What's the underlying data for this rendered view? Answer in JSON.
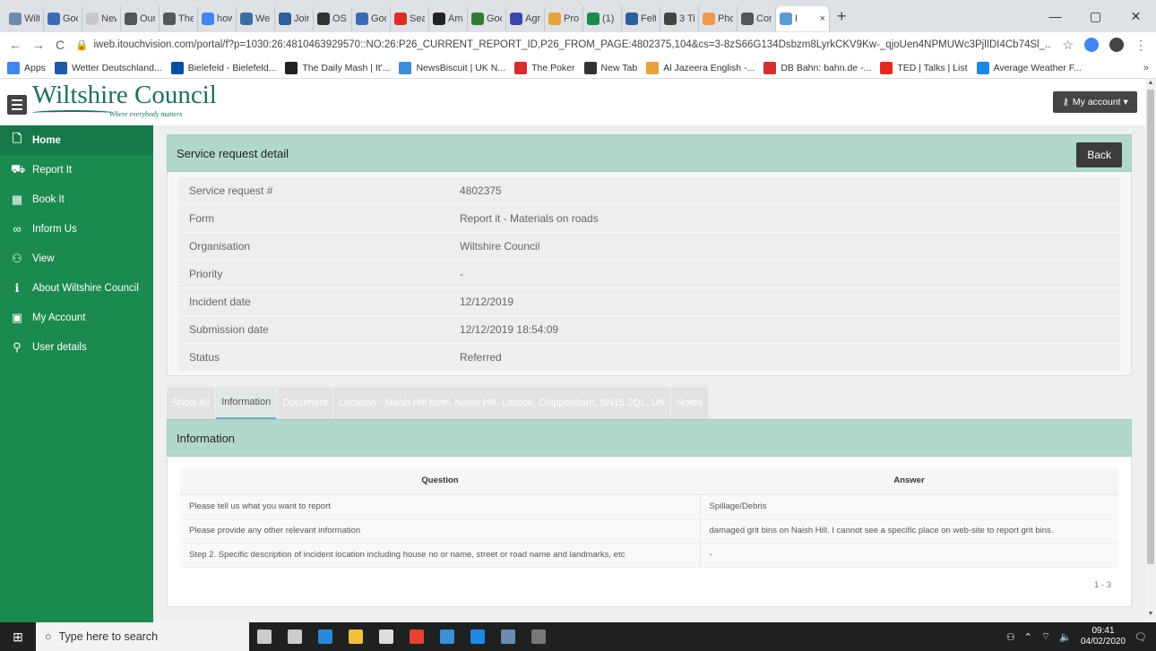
{
  "browser": {
    "tabs": [
      {
        "label": "Wilt",
        "color": "#6a8caf"
      },
      {
        "label": "Goo",
        "color": "#3b6bb5"
      },
      {
        "label": "New",
        "color": "#c9c9c9"
      },
      {
        "label": "Our",
        "color": "#555555"
      },
      {
        "label": "The",
        "color": "#555555"
      },
      {
        "label": "how",
        "color": "#4285f4"
      },
      {
        "label": "Wei",
        "color": "#3a6ea5"
      },
      {
        "label": "Join",
        "color": "#2b5f9e"
      },
      {
        "label": "OS",
        "color": "#333333"
      },
      {
        "label": "Goo",
        "color": "#3b6bb5"
      },
      {
        "label": "Sea",
        "color": "#d93025"
      },
      {
        "label": "Am",
        "color": "#222222"
      },
      {
        "label": "Goo",
        "color": "#2e7d32"
      },
      {
        "label": "Agr",
        "color": "#3949ab"
      },
      {
        "label": "Pro",
        "color": "#e6a23c"
      },
      {
        "label": "(1)",
        "color": "#1a8a4f"
      },
      {
        "label": "Felt",
        "color": "#2b5f9e"
      },
      {
        "label": "3 Ti",
        "color": "#444444"
      },
      {
        "label": "Pho",
        "color": "#f2994a"
      },
      {
        "label": "Con",
        "color": "#555555"
      }
    ],
    "active_tab": {
      "label": "I",
      "close": "×",
      "color": "#5b9bd5"
    },
    "new_tab": "+",
    "window_controls": {
      "minimize": "—",
      "maximize": "▢",
      "close": "✕"
    },
    "url": "iweb.itouchvision.com/portal/f?p=1030:26:4810463929570::NO:26:P26_CURRENT_REPORT_ID,P26_FROM_PAGE:4802375,104&cs=3-8zS66G134Dsbzm8LyrkCKV9Kw-_qjoUen4NPMUWc3PjlIDI4Cb74Sl_...",
    "bookmarks": [
      {
        "label": "Apps",
        "color": "#4285f4"
      },
      {
        "label": "Wetter Deutschland...",
        "color": "#1e5aa8"
      },
      {
        "label": "Bielefeld - Bielefeld...",
        "color": "#0b4da2"
      },
      {
        "label": "The Daily Mash | It'...",
        "color": "#222222"
      },
      {
        "label": "NewsBiscuit | UK N...",
        "color": "#3a8fd6"
      },
      {
        "label": "The Poker",
        "color": "#d32f2f"
      },
      {
        "label": "New Tab",
        "color": "#333333"
      },
      {
        "label": "Al Jazeera English -...",
        "color": "#e6a23c"
      },
      {
        "label": "DB Bahn: bahn.de -...",
        "color": "#d32f2f"
      },
      {
        "label": "TED | Talks | List",
        "color": "#e62b1e"
      },
      {
        "label": "Average Weather F...",
        "color": "#1e88e5"
      }
    ],
    "bookmarks_more": "»"
  },
  "site": {
    "logo_name": "Wiltshire Council",
    "logo_tagline": "Where everybody matters",
    "account_button": "My account ▾"
  },
  "sidebar": {
    "items": [
      {
        "label": "Home",
        "icon": "page-icon",
        "glyph": "🗋"
      },
      {
        "label": "Report It",
        "icon": "report-icon",
        "glyph": "⛟"
      },
      {
        "label": "Book It",
        "icon": "calendar-icon",
        "glyph": "▦"
      },
      {
        "label": "Inform Us",
        "icon": "infinity-icon",
        "glyph": "∞"
      },
      {
        "label": "View",
        "icon": "people-icon",
        "glyph": "⚇"
      },
      {
        "label": "About Wiltshire Council",
        "icon": "info-icon",
        "glyph": "ℹ"
      },
      {
        "label": "My Account",
        "icon": "account-icon",
        "glyph": "▣"
      },
      {
        "label": "User details",
        "icon": "user-icon",
        "glyph": "⚲"
      }
    ]
  },
  "detail": {
    "title": "Service request detail",
    "back_label": "Back",
    "rows": [
      {
        "key": "Service request #",
        "value": "4802375"
      },
      {
        "key": "Form",
        "value": "Report it - Materials on roads"
      },
      {
        "key": "Organisation",
        "value": "Wiltshire Council"
      },
      {
        "key": "Priority",
        "value": "-"
      },
      {
        "key": "Incident date",
        "value": "12/12/2019"
      },
      {
        "key": "Submission date",
        "value": "12/12/2019 18:54:09"
      },
      {
        "key": "Status",
        "value": "Referred"
      }
    ]
  },
  "tabs": [
    {
      "label": "Show All"
    },
    {
      "label": "Information"
    },
    {
      "label": "Document"
    },
    {
      "label": "Location - Naish Hill farm, Naish Hill, Lacock, Chippenham, SN15 2QL, UK"
    },
    {
      "label": "Notes"
    }
  ],
  "info": {
    "title": "Information",
    "col_question": "Question",
    "col_answer": "Answer",
    "rows": [
      {
        "question": "Please tell us what you want to report",
        "answer": "Spillage/Debris"
      },
      {
        "question": "Please provide any other relevant information",
        "answer": "damaged grit bins on Naish Hill. I cannot see a specific place on web-site to report grit bins."
      },
      {
        "question": "Step 2. Specific description of incident location including house no or name, street or road name and landmarks, etc",
        "answer": "-"
      }
    ],
    "pager": "1 - 3"
  },
  "taskbar": {
    "search_placeholder": "Type here to search",
    "apps": [
      {
        "name": "microphone-icon",
        "color": "#cccccc"
      },
      {
        "name": "task-view-icon",
        "color": "#cccccc"
      },
      {
        "name": "edge-icon",
        "color": "#2b88d8"
      },
      {
        "name": "file-explorer-icon",
        "color": "#f3c03d"
      },
      {
        "name": "mail-icon",
        "color": "#dddddd"
      },
      {
        "name": "chrome-icon",
        "color": "#e94235"
      },
      {
        "name": "app-icon",
        "color": "#3a8fd6"
      },
      {
        "name": "app-icon-2",
        "color": "#1e88e5"
      },
      {
        "name": "app-icon-3",
        "color": "#6a8caf"
      },
      {
        "name": "app-icon-4",
        "color": "#777777"
      }
    ],
    "time": "09:41",
    "date": "04/02/2020"
  }
}
